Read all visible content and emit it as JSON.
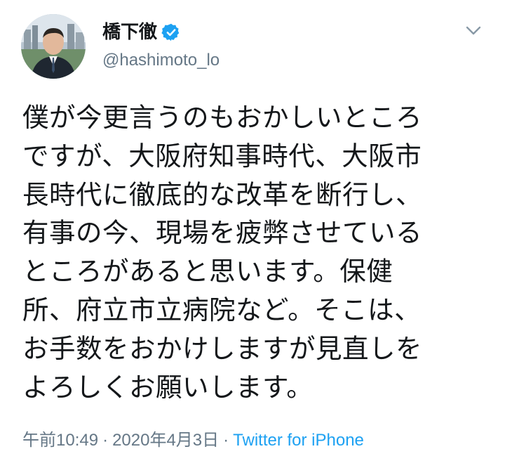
{
  "tweet": {
    "display_name": "橋下徹",
    "handle": "@hashimoto_lo",
    "verified": true,
    "body_lines": [
      "僕が今更言うのもおかしいところ",
      "ですが、大阪府知事時代、大阪市",
      "長時代に徹底的な改革を断行し、",
      "有事の今、現場を疲弊させている",
      "ところがあると思います。保健",
      "所、府立市立病院など。そこは、",
      "お手数をおかけしますが見直しを",
      "よろしくお願いします。"
    ],
    "time": "午前10:49",
    "separator": "·",
    "date": "2020年4月3日",
    "source": "Twitter for iPhone"
  },
  "icons": {
    "verified": "verified-badge-icon",
    "menu": "chevron-down-icon"
  },
  "colors": {
    "text": "#14171a",
    "secondary": "#657786",
    "accent": "#1da1f2"
  }
}
